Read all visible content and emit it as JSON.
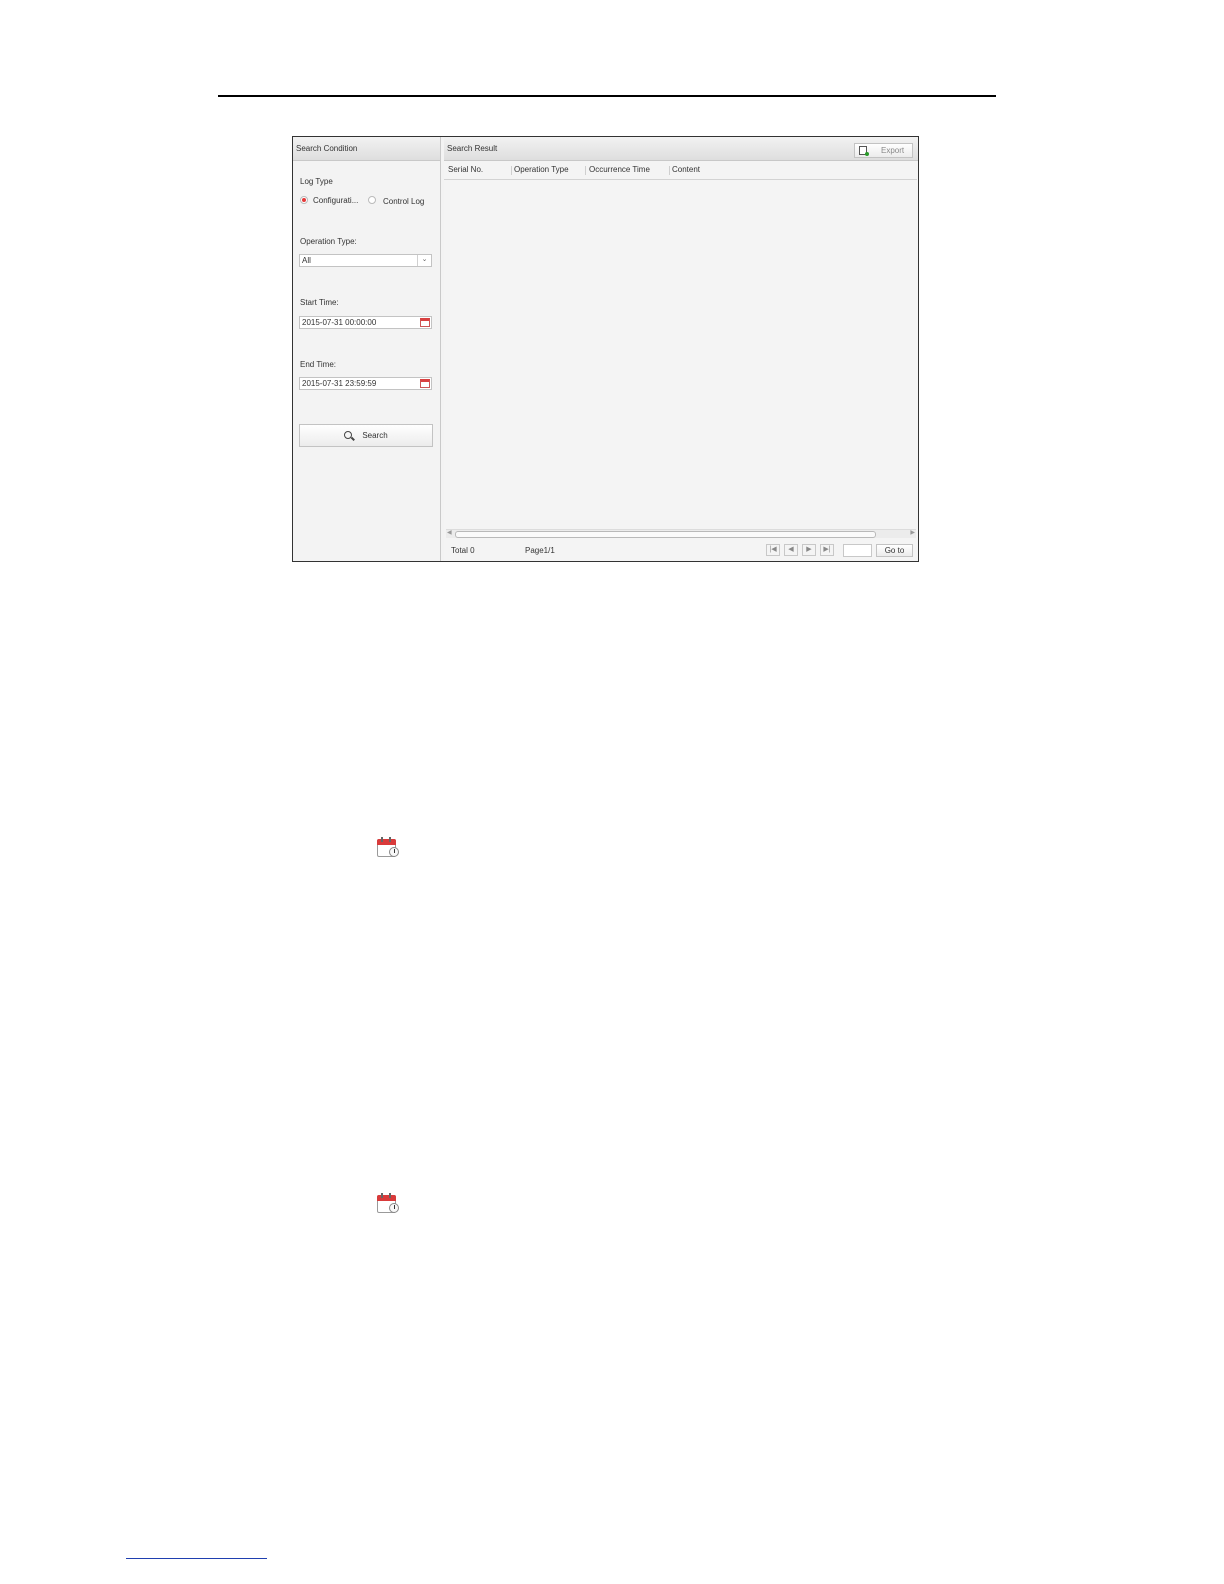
{
  "left_panel": {
    "title": "Search Condition",
    "log_type_label": "Log Type",
    "log_type_options": [
      "Configurati...",
      "Control Log"
    ],
    "operation_type_label": "Operation Type:",
    "operation_type_value": "All",
    "start_time_label": "Start Time:",
    "start_time_value": "2015-07-31 00:00:00",
    "end_time_label": "End Time:",
    "end_time_value": "2015-07-31 23:59:59",
    "search_label": "Search"
  },
  "right_panel": {
    "title": "Search Result",
    "export_label": "Export",
    "columns": [
      "Serial No.",
      "Operation Type",
      "Occurrence Time",
      "Content"
    ],
    "total_label": "Total 0",
    "page_label": "Page1/1",
    "goto_label": "Go to"
  },
  "icons": {
    "calendar": "calendar-icon",
    "search": "search-icon",
    "export": "export-icon"
  },
  "colors": {
    "radio_selected": "#e53a3a",
    "calendar_red": "#d93a3a"
  }
}
